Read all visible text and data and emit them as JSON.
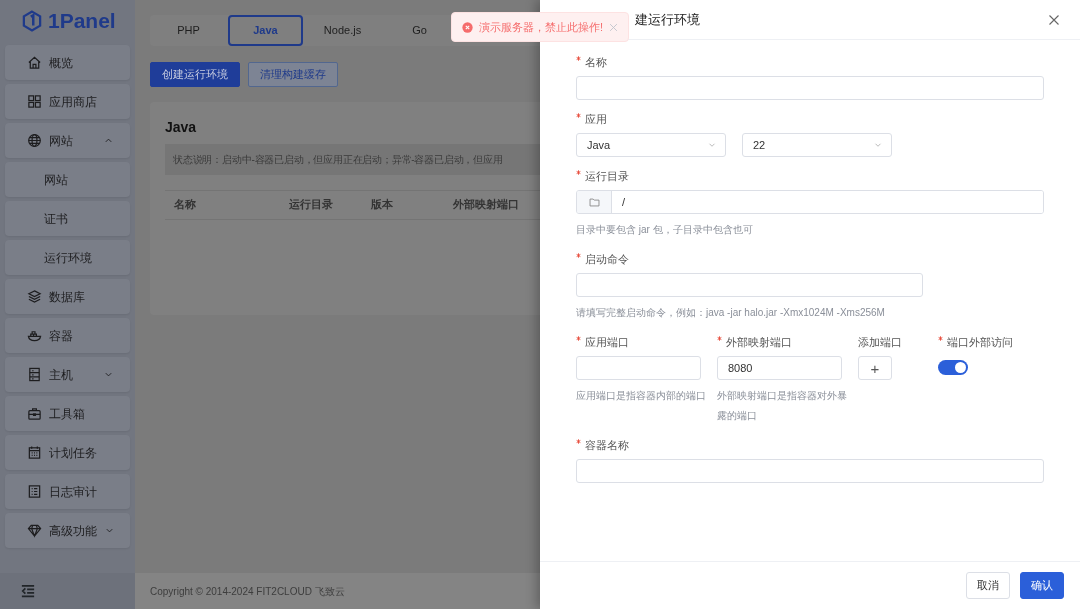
{
  "app": {
    "logo": "1Panel"
  },
  "sidebar": {
    "items": [
      {
        "label": "概览"
      },
      {
        "label": "应用商店"
      },
      {
        "label": "网站",
        "expanded": true,
        "children": [
          {
            "label": "网站"
          },
          {
            "label": "证书"
          },
          {
            "label": "运行环境"
          }
        ]
      },
      {
        "label": "数据库"
      },
      {
        "label": "容器"
      },
      {
        "label": "主机",
        "expanded": false
      },
      {
        "label": "工具箱"
      },
      {
        "label": "计划任务"
      },
      {
        "label": "日志审计"
      },
      {
        "label": "高级功能",
        "expanded": false
      }
    ]
  },
  "tabs": [
    {
      "label": "PHP",
      "selected": false
    },
    {
      "label": "Java",
      "selected": true
    },
    {
      "label": "Node.js",
      "selected": false
    },
    {
      "label": "Go",
      "selected": false
    }
  ],
  "toolbar": [
    {
      "label": "创建运行环境",
      "kind": "primary"
    },
    {
      "label": "清理构建缓存",
      "kind": "secondary"
    }
  ],
  "panel": {
    "title": "Java",
    "note": "状态说明：启动中-容器已启动，但应用正在启动；异常-容器已启动，但应用",
    "columns": [
      "名称",
      "运行目录",
      "版本",
      "外部映射端口"
    ]
  },
  "footer": "Copyright © 2014-2024 FIT2CLOUD 飞致云",
  "toast": {
    "message": "演示服务器，禁止此操作!"
  },
  "drawer": {
    "title": "建运行环境",
    "fields": [
      {
        "kind": "text",
        "label": "名称",
        "required": true
      },
      {
        "kind": "selects",
        "label": "应用",
        "required": true,
        "selects": [
          {
            "value": "Java"
          },
          {
            "value": "22"
          }
        ]
      },
      {
        "kind": "path",
        "label": "运行目录",
        "required": true,
        "value": "/",
        "help": "目录中要包含 jar 包，子目录中包含也可"
      },
      {
        "kind": "short-text",
        "label": "启动命令",
        "required": true,
        "help": "请填写完整启动命令，例如：java -jar halo.jar -Xmx1024M -Xms256M"
      },
      {
        "kind": "ports",
        "columns": [
          {
            "kind": "input",
            "label": "应用端口",
            "required": true,
            "help": "应用端口是指容器内部的端口"
          },
          {
            "kind": "input",
            "label": "外部映射端口",
            "required": true,
            "value": "8080",
            "help": "外部映射端口是指容器对外暴露的端口"
          },
          {
            "kind": "add",
            "label": "添加端口",
            "required": false,
            "symbol": "+"
          },
          {
            "kind": "switch",
            "label": "端口外部访问",
            "required": true,
            "on": true
          }
        ]
      },
      {
        "kind": "text",
        "label": "容器名称",
        "required": true
      }
    ],
    "buttons": [
      {
        "label": "取消",
        "kind": "secondary"
      },
      {
        "label": "确认",
        "kind": "primary"
      }
    ]
  }
}
